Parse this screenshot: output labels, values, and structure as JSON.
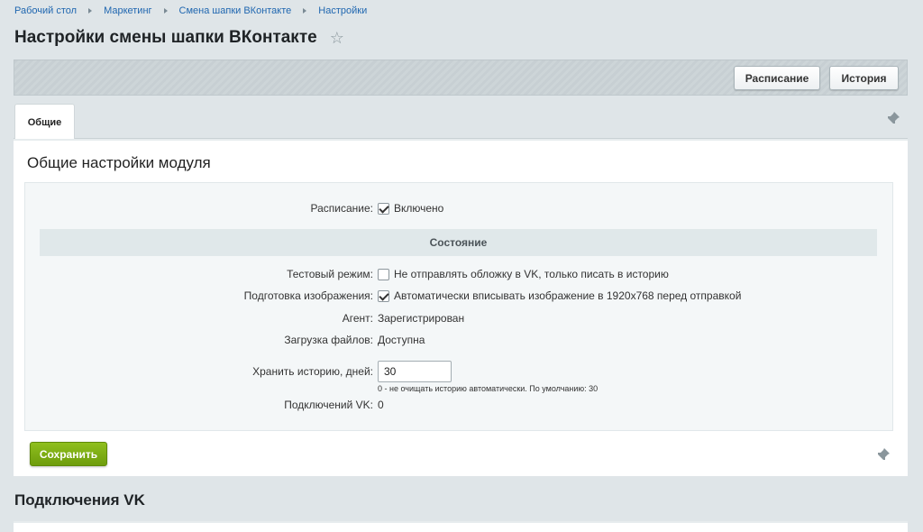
{
  "breadcrumb": [
    "Рабочий стол",
    "Маркетинг",
    "Смена шапки ВКонтакте",
    "Настройки"
  ],
  "page_title": "Настройки смены шапки ВКонтакте",
  "toolbar": {
    "schedule_button": "Расписание",
    "history_button": "История"
  },
  "tabs": [
    {
      "label": "Общие",
      "active": true
    }
  ],
  "section_title": "Общие настройки модуля",
  "settings": {
    "schedule": {
      "label": "Расписание:",
      "value": "Включено",
      "checked": true
    },
    "state_header": "Состояние",
    "test_mode": {
      "label": "Тестовый режим:",
      "value": "Не отправлять обложку в VK, только писать в историю",
      "checked": false
    },
    "image_prep": {
      "label": "Подготовка изображения:",
      "value": "Автоматически вписывать изображение в 1920x768 перед отправкой",
      "checked": true
    },
    "agent": {
      "label": "Агент:",
      "value": "Зарегистрирован"
    },
    "file_upload": {
      "label": "Загрузка файлов:",
      "value": "Доступна"
    },
    "history_days": {
      "label": "Хранить историю, дней:",
      "value": "30",
      "hint": "0 - не очищать историю автоматически. По умолчанию: 30"
    },
    "vk_connections": {
      "label": "Подключений VK:",
      "value": "0"
    }
  },
  "save_button": "Сохранить",
  "connections_heading": "Подключения VK",
  "colors": {
    "link": "#2067b0",
    "save_green": "#7aab12",
    "background": "#dfe5e8"
  }
}
